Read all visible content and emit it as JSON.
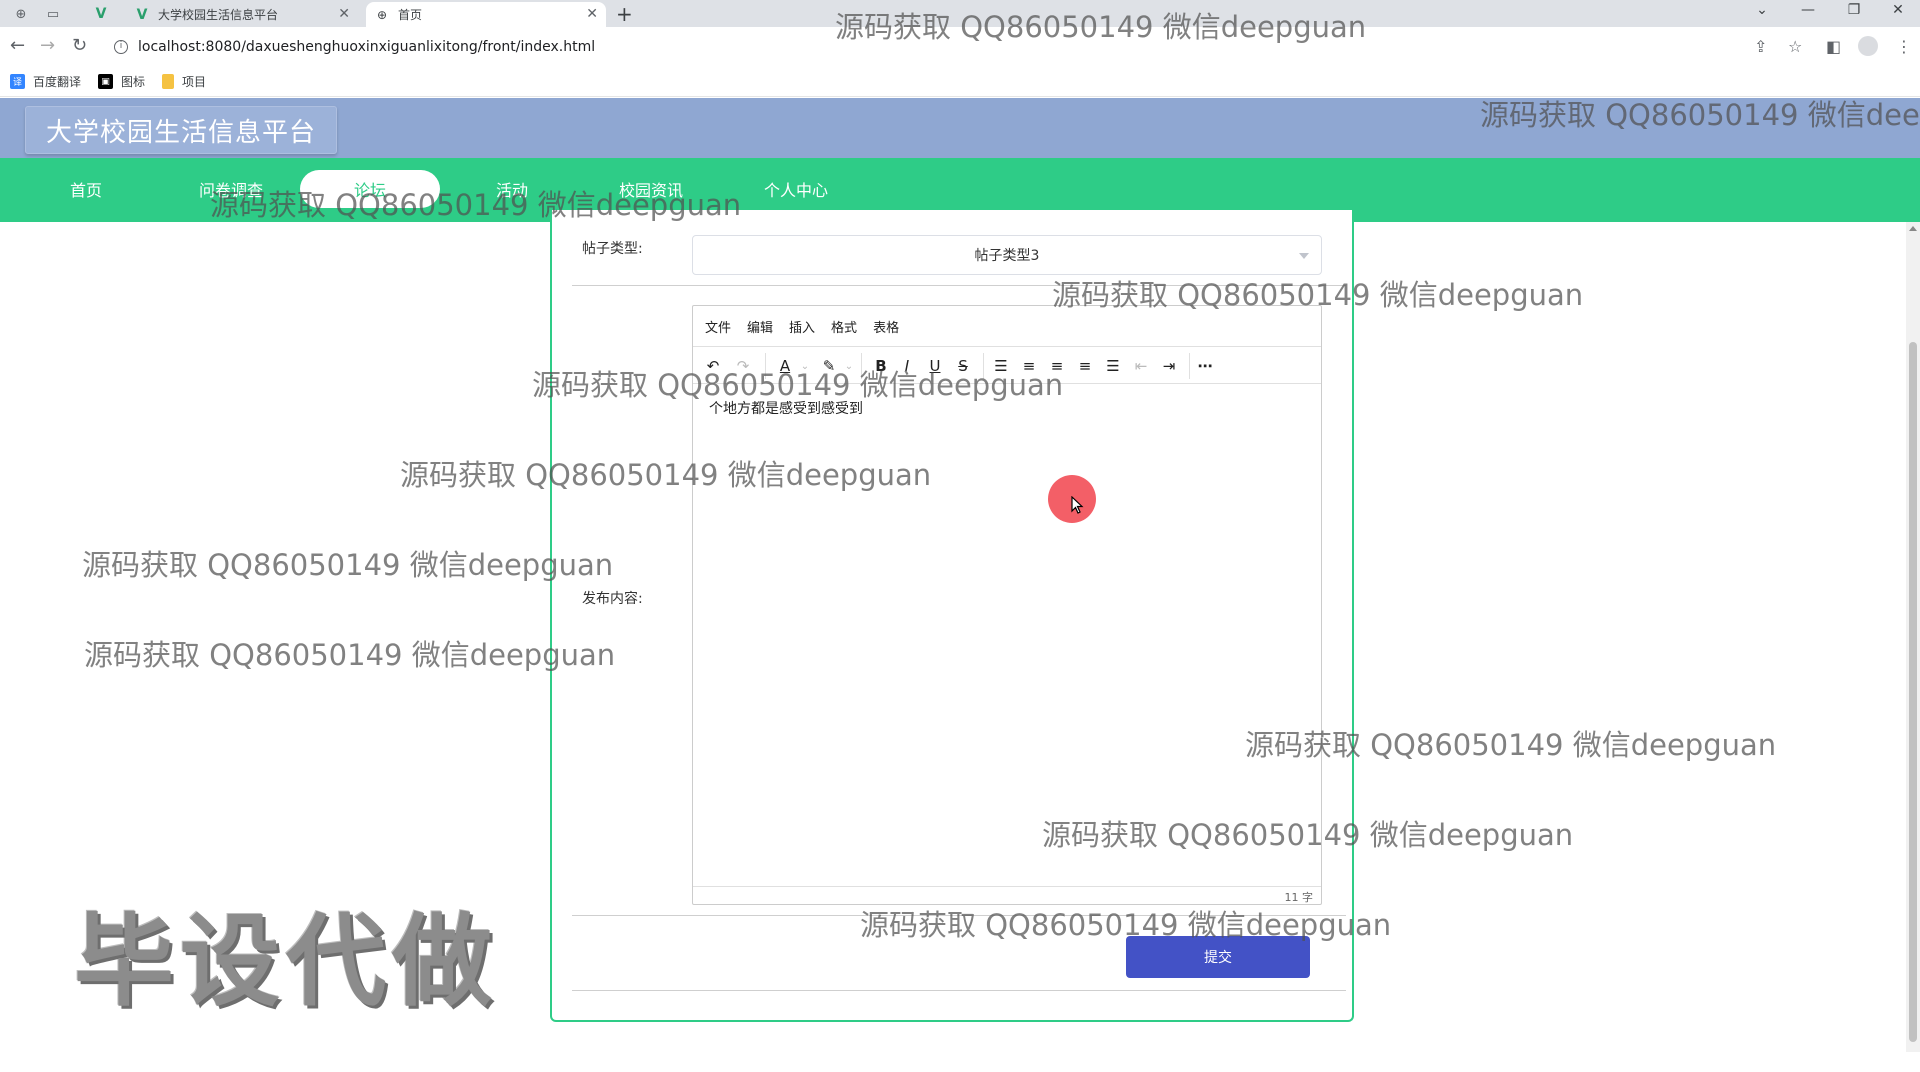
{
  "browser": {
    "tabs": [
      {
        "title": "大学校园生活信息平台",
        "active": false
      },
      {
        "title": "首页",
        "active": true
      }
    ],
    "url": "localhost:8080/daxueshenghuoxinxiguanlixitong/front/index.html",
    "bookmarks": [
      {
        "label": "百度翻译",
        "icon": "translate-icon",
        "color": "#3385ff"
      },
      {
        "label": "图标",
        "icon": "image-icon",
        "color": "#000000"
      },
      {
        "label": "项目",
        "icon": "folder-icon",
        "color": "#f5c242"
      }
    ]
  },
  "site": {
    "title": "大学校园生活信息平台",
    "nav": [
      {
        "label": "首页",
        "active": false
      },
      {
        "label": "问卷调查",
        "active": false
      },
      {
        "label": "论坛",
        "active": true
      },
      {
        "label": "活动",
        "active": false
      },
      {
        "label": "校园资讯",
        "active": false
      },
      {
        "label": "个人中心",
        "active": false
      }
    ],
    "colors": {
      "header": "#8fa7d2",
      "nav": "#2ecc87",
      "submit": "#4352c6"
    }
  },
  "form": {
    "post_type_label": "帖子类型:",
    "post_type_value": "帖子类型3",
    "content_label": "发布内容:",
    "editor_menu": [
      "文件",
      "编辑",
      "插入",
      "格式",
      "表格"
    ],
    "content_text": "个地方都是感受到感受到",
    "word_count": "11 字",
    "submit_label": "提交"
  },
  "watermarks": [
    "源码获取 QQ86050149 微信deepguan",
    "毕设代做"
  ]
}
